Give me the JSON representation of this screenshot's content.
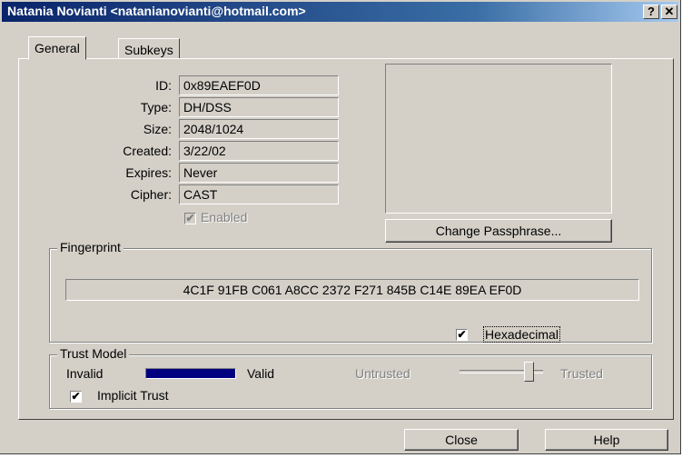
{
  "window": {
    "title": "Natania Novianti <nataniano​vianti@hotmail.com>",
    "help_glyph": "?",
    "close_glyph": "✕"
  },
  "tabs": [
    {
      "label": "General"
    },
    {
      "label": "Subkeys"
    }
  ],
  "general": {
    "id_label": "ID:",
    "id_value": "0x89EAEF0D",
    "type_label": "Type:",
    "type_value": "DH/DSS",
    "size_label": "Size:",
    "size_value": "2048/1024",
    "created_label": "Created:",
    "created_value": "3/22/02",
    "expires_label": "Expires:",
    "expires_value": "Never",
    "cipher_label": "Cipher:",
    "cipher_value": "CAST",
    "enabled_label": "Enabled",
    "enabled_checked": true,
    "change_passphrase_label": "Change Passphrase..."
  },
  "fingerprint": {
    "group_label": "Fingerprint",
    "value": "4C1F 91FB C061 A8CC 2372  F271 845B C14E 89EA EF0D",
    "hexadecimal_label": "Hexadecimal",
    "hexadecimal_checked": true
  },
  "trust_model": {
    "group_label": "Trust Model",
    "invalid_label": "Invalid",
    "valid_label": "Valid",
    "validity_level": 1.0,
    "untrusted_label": "Untrusted",
    "trusted_label": "Trusted",
    "trust_level": 1.0,
    "implicit_trust_label": "Implicit Trust",
    "implicit_trust_checked": true,
    "bar_color": "#000080"
  },
  "buttons": {
    "close_label": "Close",
    "help_label": "Help"
  }
}
